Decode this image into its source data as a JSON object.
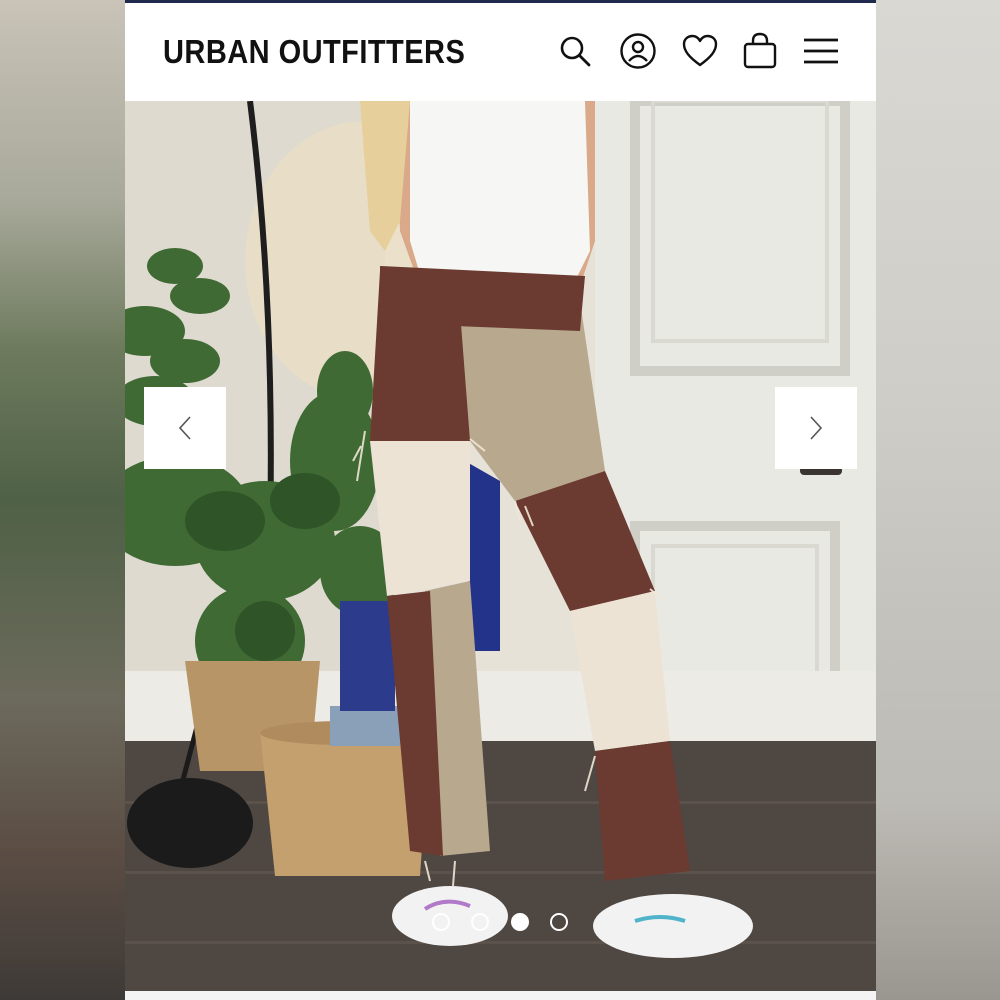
{
  "header": {
    "logo_text": "URBAN OUTFITTERS",
    "icons": [
      "search-icon",
      "account-icon",
      "wishlist-heart-icon",
      "shopping-bag-icon",
      "menu-hamburger-icon"
    ]
  },
  "carousel": {
    "image_description_icon": "product-photo-patchwork-jeans",
    "prev_icon": "chevron-left-icon",
    "next_icon": "chevron-right-icon",
    "slide_count": 4,
    "active_index": 2
  },
  "colors": {
    "brand_text": "#111111",
    "header_bg": "#ffffff",
    "top_accent": "#1f2a4d",
    "jeans_brown": "#6b3a30",
    "jeans_tan": "#b8a88d",
    "jeans_cream": "#ece3d4"
  }
}
